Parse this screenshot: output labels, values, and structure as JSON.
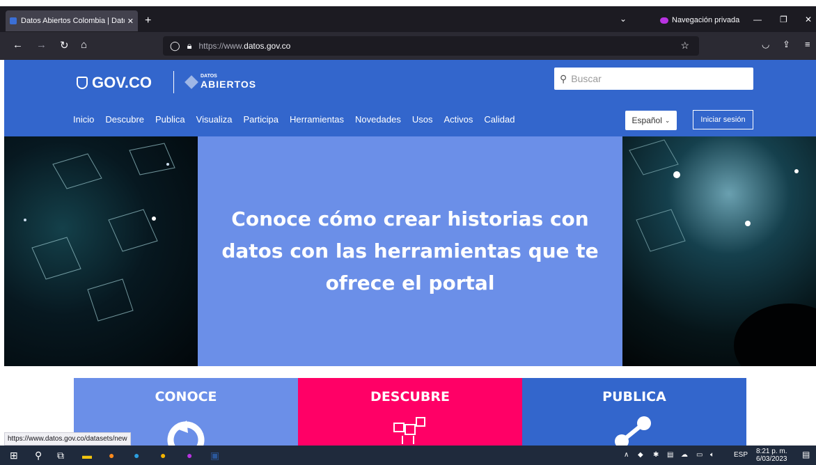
{
  "browser": {
    "tab_title": "Datos Abiertos Colombia | Dato",
    "private_label": "Navegación privada",
    "url_prefix": "https://www.",
    "url_domain": "datos.gov.co",
    "status_url": "https://www.datos.gov.co/datasets/new"
  },
  "site": {
    "logo_gov": "GOV.CO",
    "logo_datos_small": "DATOS",
    "logo_datos_big": "ABIERTOS",
    "search_placeholder": "Buscar",
    "menu": [
      "Inicio",
      "Descubre",
      "Publica",
      "Visualiza",
      "Participa",
      "Herramientas",
      "Novedades",
      "Usos",
      "Activos",
      "Calidad"
    ],
    "language": "Español",
    "login": "Iniciar sesión"
  },
  "hero": {
    "headline": "Conoce cómo crear historias con datos con las herramientas que te ofrece el portal"
  },
  "cards": [
    {
      "title": "CONOCE",
      "color": "#6b8fe8"
    },
    {
      "title": "DESCUBRE",
      "color": "#ff0066"
    },
    {
      "title": "PUBLICA",
      "color": "#3366cc"
    }
  ],
  "taskbar": {
    "lang": "ESP",
    "time": "8:21 p. m.",
    "date": "6/03/2023"
  }
}
